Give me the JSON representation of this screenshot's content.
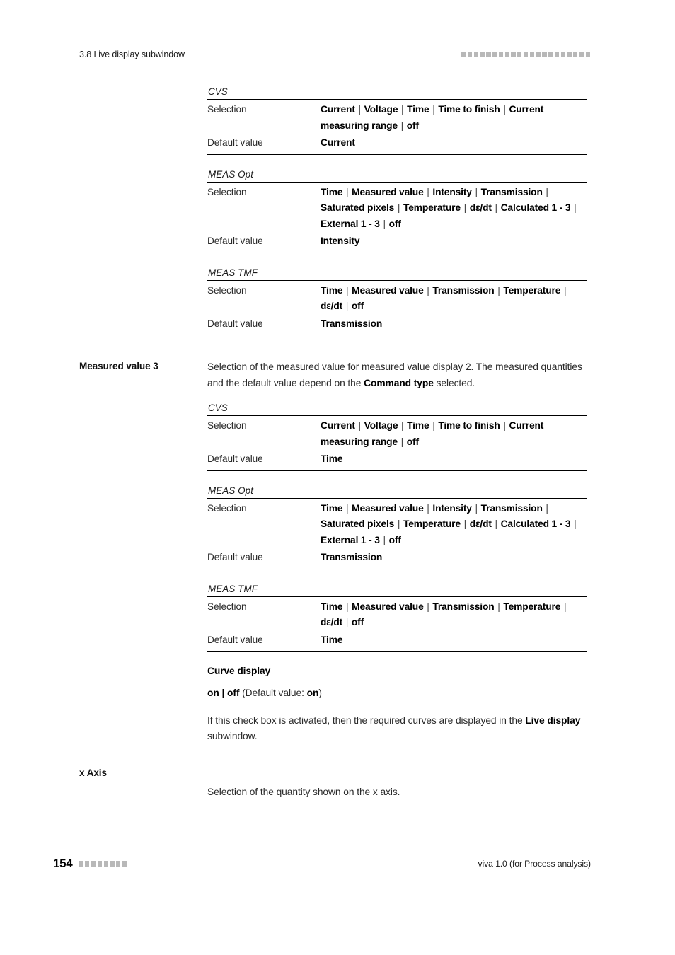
{
  "header": {
    "section_title": "3.8 Live display subwindow",
    "rule_squares": 21
  },
  "footer": {
    "page_number": "154",
    "rule_squares": 8,
    "document_title": "viva 1.0 (for Process analysis)"
  },
  "labels": {
    "selection": "Selection",
    "default_value": "Default value"
  },
  "blocks": [
    {
      "margin_heading": "",
      "tables": [
        {
          "title": "CVS",
          "selection": "Current | Voltage | Time | Time to finish | Current measuring range | off",
          "default": "Current"
        },
        {
          "title": "MEAS Opt",
          "selection": "Time | Measured value | Intensity | Transmission | Saturated pixels | Temperature | dε/dt | Calculated 1 - 3 | External 1 - 3 | off",
          "default": "Intensity"
        },
        {
          "title": "MEAS TMF",
          "selection": "Time | Measured value | Transmission | Temperature | dε/dt | off",
          "default": "Transmission"
        }
      ]
    },
    {
      "margin_heading": "Measured value 3",
      "intro_part1": "Selection of the measured value for measured value display 2. The measured quantities and the default value depend on the ",
      "intro_bold": "Command type",
      "intro_part2": " selected.",
      "tables": [
        {
          "title": "CVS",
          "selection": "Current | Voltage | Time | Time to finish | Current measuring range | off",
          "default": "Time"
        },
        {
          "title": "MEAS Opt",
          "selection": "Time | Measured value | Intensity | Transmission | Saturated pixels | Temperature | dε/dt | Calculated 1 - 3 | External 1 - 3 | off",
          "default": "Transmission"
        },
        {
          "title": "MEAS TMF",
          "selection": "Time | Measured value | Transmission | Temperature | dε/dt | off",
          "default": "Time"
        }
      ]
    }
  ],
  "curve_display": {
    "heading": "Curve display",
    "values_bold": "on | off",
    "default_note": " (Default value: ",
    "default_bold": "on",
    "default_note_end": ")",
    "description_part1": "If this check box is activated, then the required curves are displayed in the ",
    "description_bold": "Live display",
    "description_part2": " subwindow."
  },
  "x_axis": {
    "margin_heading": "x Axis",
    "description": "Selection of the quantity shown on the x axis."
  }
}
